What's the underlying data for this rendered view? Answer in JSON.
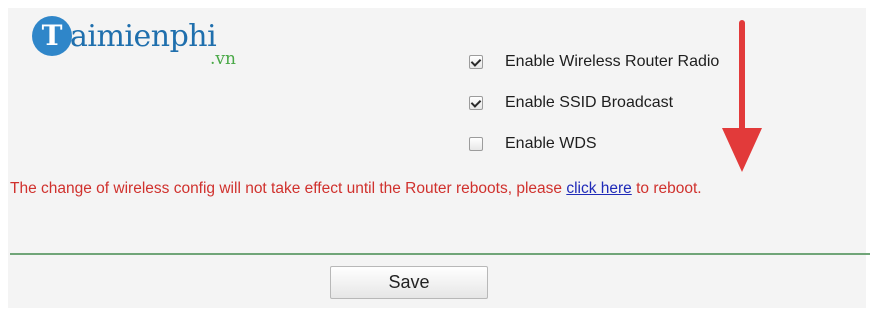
{
  "logo": {
    "mark": "T",
    "text": "aimienphi",
    "domain": ".vn"
  },
  "options": {
    "radio_label": "Enable Wireless Router Radio",
    "radio_checked": true,
    "ssid_label": "Enable SSID Broadcast",
    "ssid_checked": true,
    "wds_label": "Enable WDS",
    "wds_checked": false
  },
  "notice": {
    "before_link": "The change of wireless config will not take effect until the Router reboots, please ",
    "link_text": "click here",
    "after_link": " to reboot."
  },
  "actions": {
    "save_label": "Save"
  },
  "colors": {
    "notice_text": "#d0312d",
    "link": "#1f2ab8",
    "arrow": "#e23a3a",
    "divider": "#70a578"
  },
  "icons": {
    "annotation": "down-arrow-icon"
  }
}
